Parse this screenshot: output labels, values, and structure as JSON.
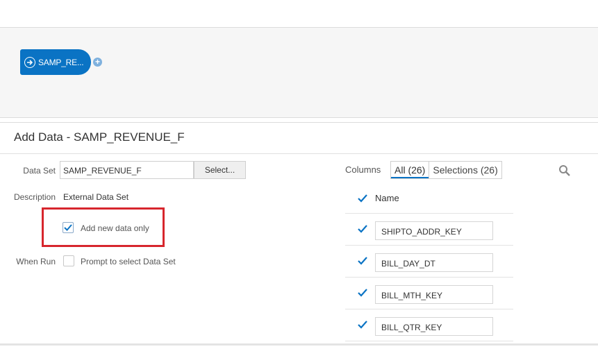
{
  "flow": {
    "node_label": "SAMP_RE...",
    "add_symbol": "+"
  },
  "panel": {
    "title": "Add Data - SAMP_REVENUE_F"
  },
  "form": {
    "data_set_label": "Data Set",
    "data_set_value": "SAMP_REVENUE_F",
    "select_button": "Select...",
    "description_label": "Description",
    "description_value": "External Data Set",
    "add_new_data_only_label": "Add new data only",
    "add_new_data_only_checked": true,
    "when_run_label": "When Run",
    "prompt_label": "Prompt to select Data Set",
    "prompt_checked": false
  },
  "columns": {
    "label": "Columns",
    "tabs": [
      {
        "label": "All (26)",
        "active": true
      },
      {
        "label": "Selections (26)",
        "active": false
      }
    ],
    "header": "Name",
    "rows": [
      {
        "name": "SHIPTO_ADDR_KEY",
        "checked": true
      },
      {
        "name": "BILL_DAY_DT",
        "checked": true
      },
      {
        "name": "BILL_MTH_KEY",
        "checked": true
      },
      {
        "name": "BILL_QTR_KEY",
        "checked": true
      }
    ]
  },
  "colors": {
    "accent": "#0a73c4",
    "highlight": "#d7262d"
  }
}
